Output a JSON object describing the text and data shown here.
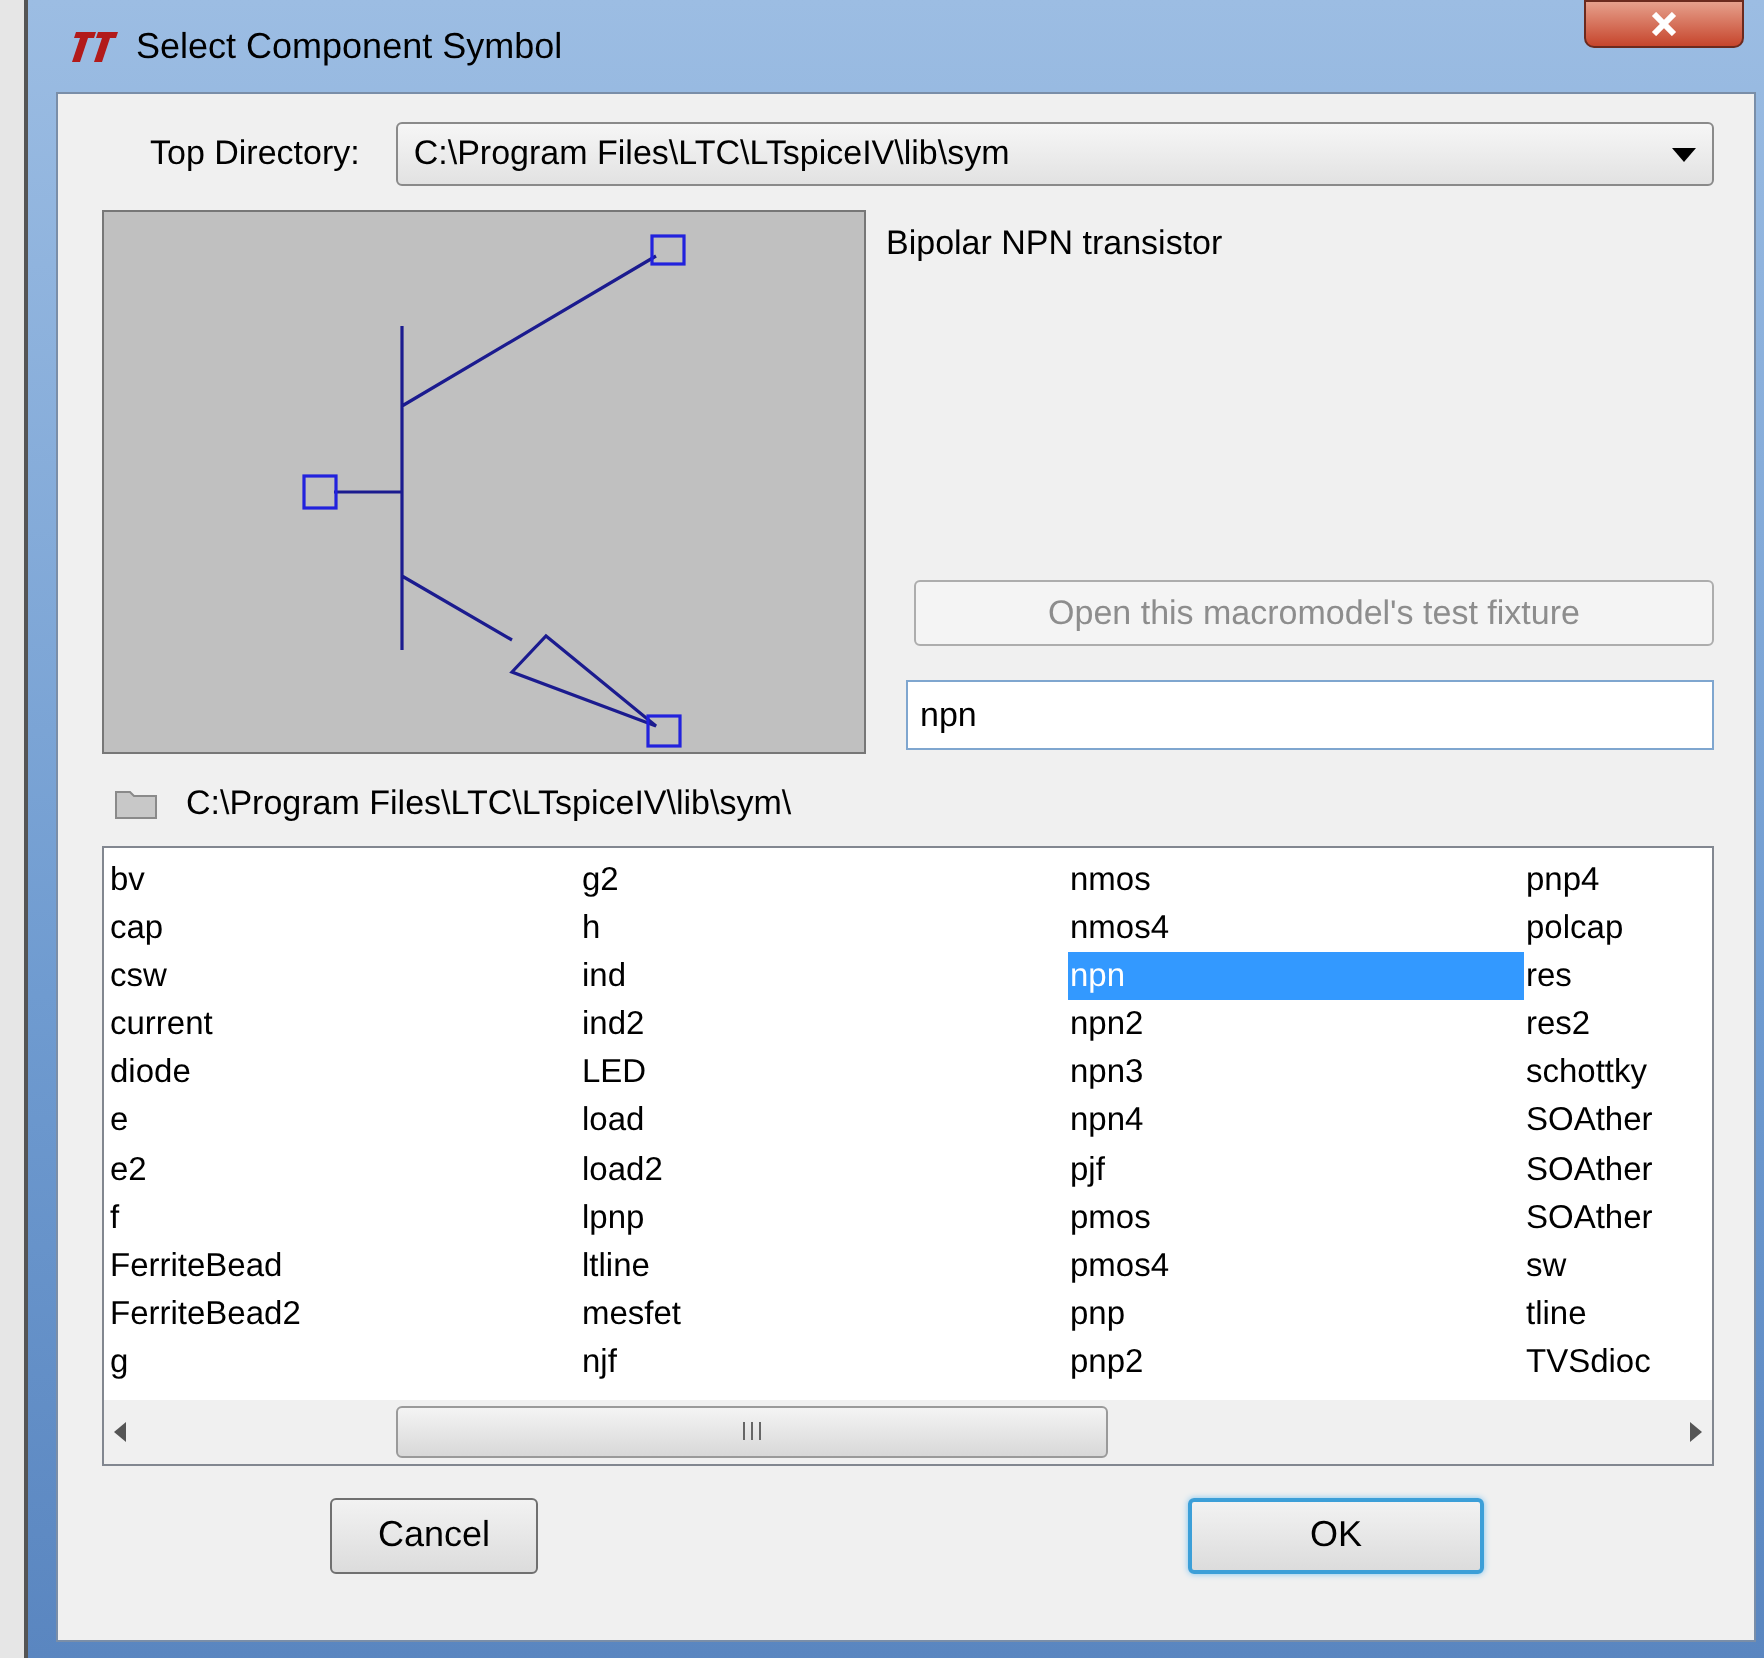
{
  "window": {
    "title": "Select Component Symbol"
  },
  "top_directory": {
    "label": "Top Directory:",
    "value": "C:\\Program Files\\LTC\\LTspiceIV\\lib\\sym"
  },
  "description": "Bipolar NPN transistor",
  "test_fixture_button": {
    "label": "Open this macromodel's test fixture",
    "disabled": true
  },
  "search": {
    "value": "npn"
  },
  "path": "C:\\Program Files\\LTC\\LTspiceIV\\lib\\sym\\",
  "symbols": [
    {
      "label": "bv",
      "selected": false
    },
    {
      "label": "cap",
      "selected": false
    },
    {
      "label": "csw",
      "selected": false
    },
    {
      "label": "current",
      "selected": false
    },
    {
      "label": "diode",
      "selected": false
    },
    {
      "label": "e",
      "selected": false
    },
    {
      "label": "e2",
      "selected": false
    },
    {
      "label": "f",
      "selected": false
    },
    {
      "label": "FerriteBead",
      "selected": false
    },
    {
      "label": "FerriteBead2",
      "selected": false
    },
    {
      "label": "g",
      "selected": false
    },
    {
      "label": "g2",
      "selected": false
    },
    {
      "label": "h",
      "selected": false
    },
    {
      "label": "ind",
      "selected": false
    },
    {
      "label": "ind2",
      "selected": false
    },
    {
      "label": "LED",
      "selected": false
    },
    {
      "label": "load",
      "selected": false
    },
    {
      "label": "load2",
      "selected": false
    },
    {
      "label": "lpnp",
      "selected": false
    },
    {
      "label": "ltline",
      "selected": false
    },
    {
      "label": "mesfet",
      "selected": false
    },
    {
      "label": "njf",
      "selected": false
    },
    {
      "label": "nmos",
      "selected": false
    },
    {
      "label": "nmos4",
      "selected": false
    },
    {
      "label": "npn",
      "selected": true
    },
    {
      "label": "npn2",
      "selected": false
    },
    {
      "label": "npn3",
      "selected": false
    },
    {
      "label": "npn4",
      "selected": false
    },
    {
      "label": "pjf",
      "selected": false
    },
    {
      "label": "pmos",
      "selected": false
    },
    {
      "label": "pmos4",
      "selected": false
    },
    {
      "label": "pnp",
      "selected": false
    },
    {
      "label": "pnp2",
      "selected": false
    },
    {
      "label": "pnp4",
      "selected": false
    },
    {
      "label": "polcap",
      "selected": false
    },
    {
      "label": "res",
      "selected": false
    },
    {
      "label": "res2",
      "selected": false
    },
    {
      "label": "schottky",
      "selected": false
    },
    {
      "label": "SOAther",
      "selected": false
    },
    {
      "label": "SOAther",
      "selected": false
    },
    {
      "label": "SOAther",
      "selected": false
    },
    {
      "label": "sw",
      "selected": false
    },
    {
      "label": "tline",
      "selected": false
    },
    {
      "label": "TVSdioc",
      "selected": false
    }
  ],
  "buttons": [
    {
      "label": "Cancel",
      "default": false
    },
    {
      "label": "OK",
      "default": true
    }
  ]
}
